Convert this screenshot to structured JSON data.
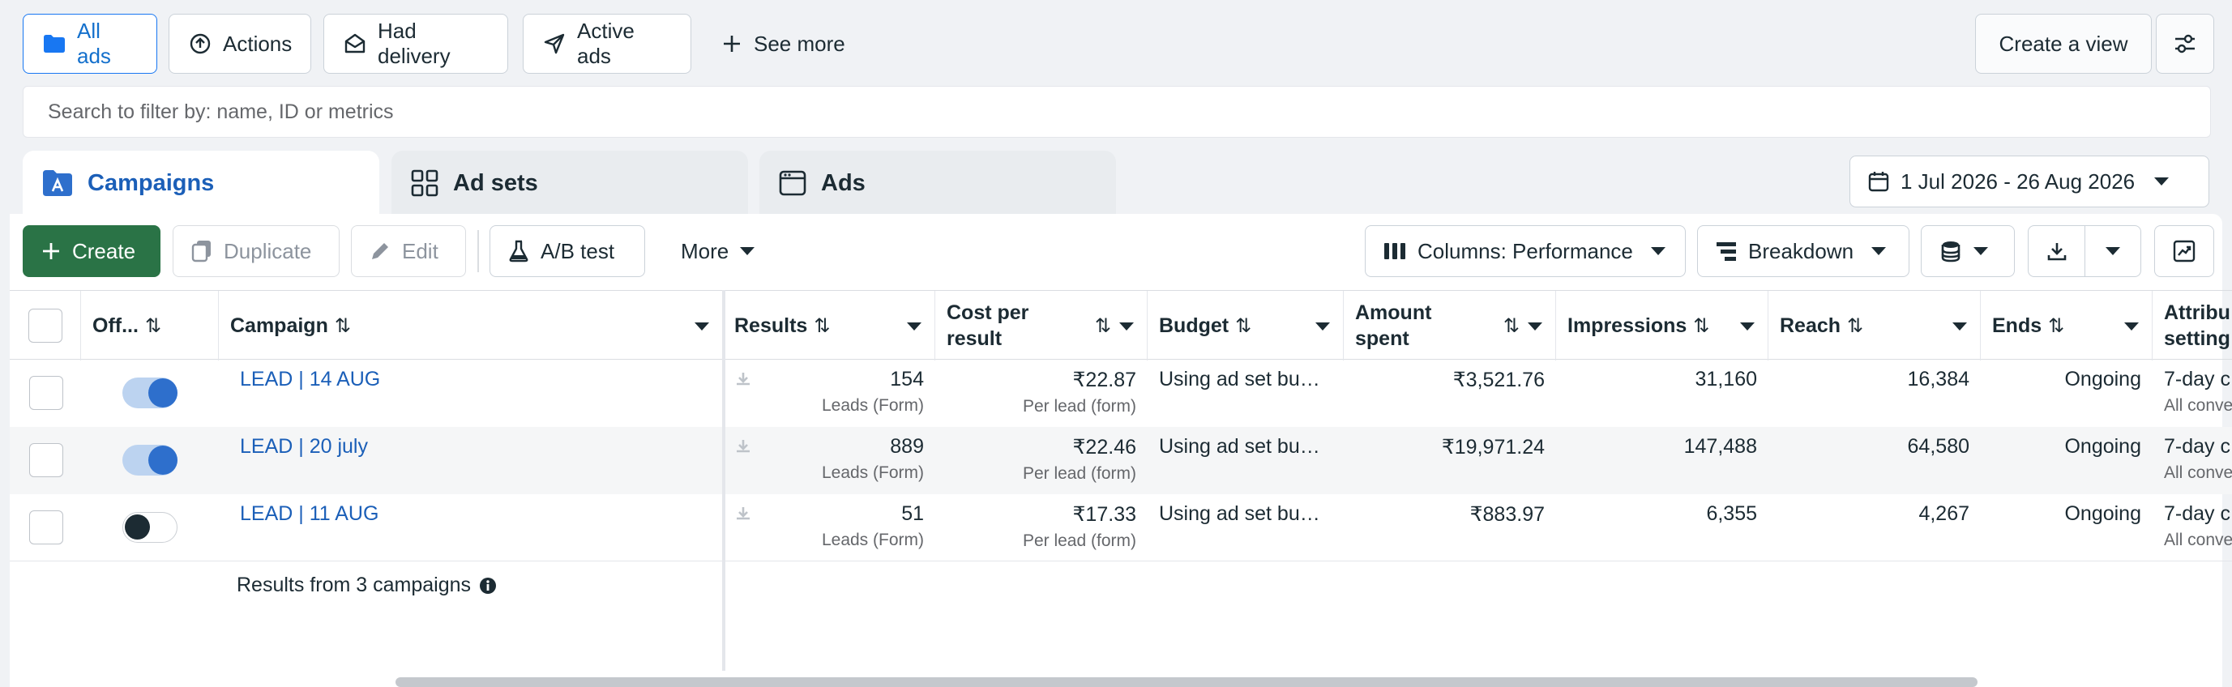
{
  "filters": {
    "all_ads": "All ads",
    "actions": "Actions",
    "had_delivery": "Had delivery",
    "active_ads": "Active ads",
    "see_more": "See more",
    "create_view": "Create a view"
  },
  "search": {
    "placeholder": "Search to filter by: name, ID or metrics"
  },
  "tabs": {
    "campaigns": "Campaigns",
    "ad_sets": "Ad sets",
    "ads": "Ads"
  },
  "date_range": "1 Jul 2026 - 26 Aug 2026",
  "toolbar": {
    "create": "Create",
    "duplicate": "Duplicate",
    "edit": "Edit",
    "ab_test": "A/B test",
    "more": "More",
    "columns": "Columns: Performance",
    "breakdown": "Breakdown"
  },
  "columns": {
    "off_on": "Off...",
    "campaign": "Campaign",
    "results": "Results",
    "cost_per_result_1": "Cost per",
    "cost_per_result_2": "result",
    "budget": "Budget",
    "amount_spent_1": "Amount",
    "amount_spent_2": "spent",
    "impressions": "Impressions",
    "reach": "Reach",
    "ends": "Ends",
    "attribution_1": "Attribu",
    "attribution_2": "setting"
  },
  "rows": [
    {
      "on": true,
      "campaign": "LEAD | 14 AUG",
      "results": "154",
      "results_type": "Leads (Form)",
      "cost": "₹22.87",
      "cost_type": "Per lead (form)",
      "budget": "Using ad set bu…",
      "amount_spent": "₹3,521.76",
      "impressions": "31,160",
      "reach": "16,384",
      "ends": "Ongoing",
      "attribution": "7-day c",
      "attribution_sub": "All conve"
    },
    {
      "on": true,
      "campaign": "LEAD | 20 july",
      "results": "889",
      "results_type": "Leads (Form)",
      "cost": "₹22.46",
      "cost_type": "Per lead (form)",
      "budget": "Using ad set bu…",
      "amount_spent": "₹19,971.24",
      "impressions": "147,488",
      "reach": "64,580",
      "ends": "Ongoing",
      "attribution": "7-day c",
      "attribution_sub": "All conve"
    },
    {
      "on": false,
      "campaign": "LEAD | 11 AUG",
      "results": "51",
      "results_type": "Leads (Form)",
      "cost": "₹17.33",
      "cost_type": "Per lead (form)",
      "budget": "Using ad set bu…",
      "amount_spent": "₹883.97",
      "impressions": "6,355",
      "reach": "4,267",
      "ends": "Ongoing",
      "attribution": "7-day c",
      "attribution_sub": "All conve"
    }
  ],
  "summary": "Results from 3 campaigns",
  "colors": {
    "accent": "#1877f2",
    "create_green": "#2a7346",
    "link": "#1b5fb8"
  }
}
